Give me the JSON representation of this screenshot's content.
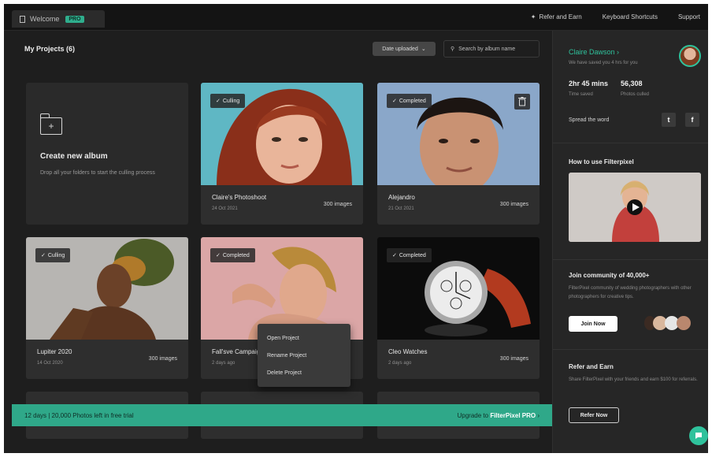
{
  "top": {
    "tab_label": "Welcome",
    "tab_badge": "PRO",
    "links": [
      "Refer and Earn",
      "Keyboard Shortcuts",
      "Support"
    ]
  },
  "main": {
    "title": "My Projects (6)",
    "sort_label": "Date uploaded",
    "search_placeholder": "Search by album name",
    "new_album": {
      "title": "Create new album",
      "desc": "Drop all your folders to start the culling process"
    },
    "cards": [
      {
        "name": "Claire's Photoshoot",
        "date": "24 Oct 2021",
        "count": "300 images",
        "status": "Culling"
      },
      {
        "name": "Alejandro",
        "date": "21 Oct 2021",
        "count": "300 images",
        "status": "Completed"
      },
      {
        "name": "Lupiter 2020",
        "date": "14 Oct 2020",
        "count": "300 images",
        "status": "Culling"
      },
      {
        "name": "Fall'sve Campaign",
        "date": "2 days ago",
        "count": "300 images",
        "status": "Completed"
      },
      {
        "name": "Cleo Watches",
        "date": "2 days ago",
        "count": "300 images",
        "status": "Completed"
      }
    ],
    "context_menu": [
      "Open Project",
      "Rename Project",
      "Delete Project"
    ],
    "banner_left": "12 days | 20,000 Photos left in free trial",
    "banner_right": "Upgrade to",
    "banner_right_bold": "FilterPixel PRO"
  },
  "side": {
    "user_name": "Claire Dawson",
    "user_sub": "We have saved you 4 hrs for you",
    "stats": [
      {
        "value": "2hr 45 mins",
        "label": "Time saved"
      },
      {
        "value": "56,308",
        "label": "Photos culled"
      }
    ],
    "spread": "Spread the word",
    "how_to": "How to use Filterpixel",
    "community_title": "Join community of 40,000+",
    "community_desc": "FilterPixel community of wedding photographers with other photographers for creative tips.",
    "join_label": "Join Now",
    "refer_title": "Refer and Earn",
    "refer_desc": "Share FilterPixel with your friends and earn $100 for referrals.",
    "refer_label": "Refer Now"
  },
  "colors": {
    "accent": "#2fae8d",
    "bg": "#1e1e1e",
    "panel": "#262626"
  }
}
